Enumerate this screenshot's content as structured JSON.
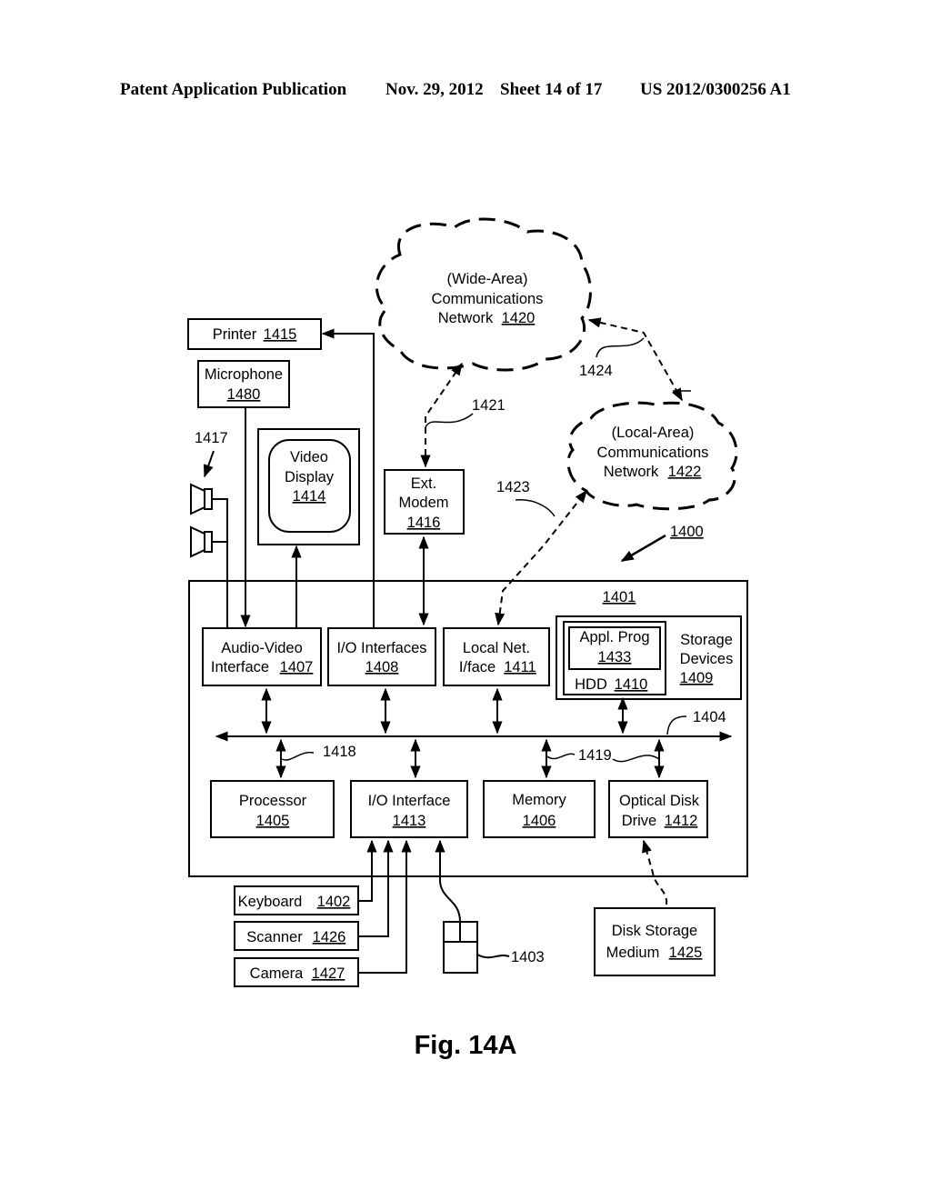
{
  "header": {
    "publication": "Patent Application Publication",
    "date": "Nov. 29, 2012",
    "sheet": "Sheet 14 of 17",
    "number": "US 2012/0300256 A1"
  },
  "figure": {
    "caption": "Fig. 14A",
    "system_ref": "1400",
    "computer_ref": "1401",
    "bus_ref": "1404"
  },
  "networks": {
    "wan": {
      "line1": "(Wide-Area)",
      "line2": "Communications",
      "line3": "Network",
      "ref": "1420"
    },
    "lan": {
      "line1": "(Local-Area)",
      "line2": "Communications",
      "line3": "Network",
      "ref": "1422"
    }
  },
  "external": {
    "printer": {
      "label": "Printer",
      "ref": "1415"
    },
    "microphone": {
      "label": "Microphone",
      "ref": "1480"
    },
    "speakers": {
      "ref": "1417"
    },
    "video_display": {
      "line1": "Video",
      "line2": "Display",
      "ref": "1414"
    },
    "modem": {
      "line1": "Ext.",
      "line2": "Modem",
      "ref": "1416"
    },
    "keyboard": {
      "label": "Keyboard",
      "ref": "1402"
    },
    "scanner": {
      "label": "Scanner",
      "ref": "1426"
    },
    "camera": {
      "label": "Camera",
      "ref": "1427"
    },
    "mouse": {
      "ref": "1403"
    },
    "disk_medium": {
      "line1": "Disk Storage",
      "line2": "Medium",
      "ref": "1425"
    }
  },
  "internal": {
    "av_interface": {
      "line1": "Audio-Video",
      "line2": "Interface",
      "ref": "1407"
    },
    "io_interfaces": {
      "line1": "I/O Interfaces",
      "ref": "1408"
    },
    "local_net": {
      "line1": "Local Net.",
      "line2": "I/face",
      "ref": "1411"
    },
    "appl_prog": {
      "line1": "Appl. Prog",
      "ref": "1433"
    },
    "hdd": {
      "label": "HDD",
      "ref": "1410"
    },
    "storage": {
      "line1": "Storage",
      "line2": "Devices",
      "ref": "1409"
    },
    "processor": {
      "line1": "Processor",
      "ref": "1405"
    },
    "io_interface": {
      "line1": "I/O Interface",
      "ref": "1413"
    },
    "memory": {
      "line1": "Memory",
      "ref": "1406"
    },
    "optical": {
      "line1": "Optical Disk",
      "line2": "Drive",
      "ref": "1412"
    }
  },
  "connections": {
    "wan_modem": "1421",
    "lan_localnet": "1423",
    "wan_lan": "1424",
    "bus_left": "1418",
    "bus_right": "1419"
  }
}
